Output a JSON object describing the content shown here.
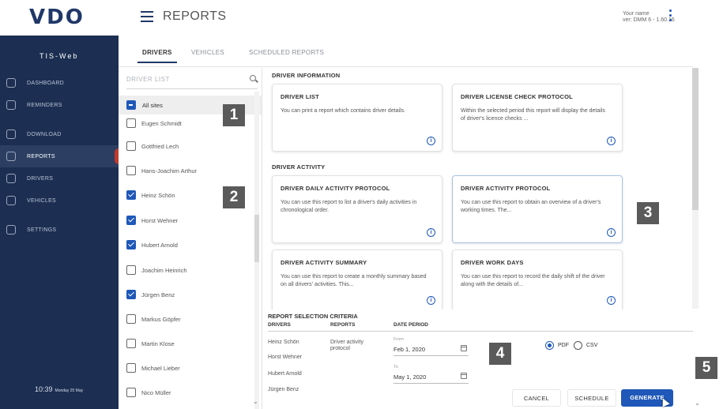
{
  "header": {
    "logo": "VDO",
    "page_title": "REPORTS",
    "user_name": "Your name",
    "user_version": "ver: DMM 6 - 1.60.16"
  },
  "sidebar": {
    "app_title": "TIS-Web",
    "items": [
      {
        "label": "DASHBOARD",
        "icon": "dashboard-icon"
      },
      {
        "label": "REMINDERS",
        "icon": "bell-icon"
      },
      {
        "label": "DOWNLOAD",
        "icon": "download-icon"
      },
      {
        "label": "REPORTS",
        "icon": "report-icon",
        "active": true
      },
      {
        "label": "DRIVERS",
        "icon": "driver-icon"
      },
      {
        "label": "VEHICLES",
        "icon": "truck-icon"
      },
      {
        "label": "SETTINGS",
        "icon": "settings-icon"
      }
    ],
    "clock_time": "10:39",
    "clock_date": "Monday 25 May"
  },
  "tabs": [
    {
      "label": "DRIVERS",
      "active": true
    },
    {
      "label": "VEHICLES",
      "active": false
    },
    {
      "label": "SCHEDULED REPORTS",
      "active": false
    }
  ],
  "driver_list": {
    "search_placeholder": "DRIVER LIST",
    "all_sites_label": "All sites",
    "drivers": [
      {
        "name": "Eugen Schmidt",
        "checked": false
      },
      {
        "name": "Gottfried Lech",
        "checked": false
      },
      {
        "name": "Hans-Joachim Arthur",
        "checked": false
      },
      {
        "name": "Heinz Schön",
        "checked": true
      },
      {
        "name": "Horst Wehner",
        "checked": true
      },
      {
        "name": "Hubert Arnold",
        "checked": true
      },
      {
        "name": "Joachim Heinrich",
        "checked": false
      },
      {
        "name": "Jürgen Benz",
        "checked": true
      },
      {
        "name": "Markus Göpfer",
        "checked": false
      },
      {
        "name": "Martin Klose",
        "checked": false
      },
      {
        "name": "Michael Lieber",
        "checked": false
      },
      {
        "name": "Nico Müller",
        "checked": false
      }
    ]
  },
  "reports": {
    "section_driver_info": "DRIVER INFORMATION",
    "section_driver_activity": "DRIVER ACTIVITY",
    "cards": [
      {
        "title": "DRIVER LIST",
        "desc": "You can print a report which contains driver details."
      },
      {
        "title": "DRIVER LICENSE CHECK PROTOCOL",
        "desc": "Within the selected period this report will display the details of driver's licence checks ..."
      },
      {
        "title": "DRIVER DAILY ACTIVITY PROTOCOL",
        "desc": "You can use this report to list a driver's daily activities in chronological order."
      },
      {
        "title": "DRIVER ACTIVITY PROTOCOL",
        "desc": "You can use this report to obtain an overview of a driver's working times. The..."
      },
      {
        "title": "DRIVER ACTIVITY SUMMARY",
        "desc": "You can use this report to create a monthly summary based on all drivers' activities. This..."
      },
      {
        "title": "DRIVER WORK DAYS",
        "desc": "You can use this report to record the daily shift of the driver along with the details of..."
      }
    ]
  },
  "criteria": {
    "title": "REPORT SELECTION CRITERIA",
    "col_drivers": "DRIVERS",
    "col_reports": "REPORTS",
    "col_period": "DATE PERIOD",
    "selected_drivers": [
      "Heinz Schön",
      "Horst Wehner",
      "Hubert Arnold",
      "Jürgen Benz"
    ],
    "selected_report": "Driver activity protocol",
    "from_label": "From",
    "from_value": "Feb 1, 2020",
    "to_label": "To",
    "to_value": "May 1, 2020",
    "format_pdf": "PDF",
    "format_csv": "CSV",
    "cancel": "CANCEL",
    "schedule": "SCHEDULE",
    "generate": "GENERATE"
  },
  "callouts": [
    "1",
    "2",
    "3",
    "4",
    "5"
  ],
  "colors": {
    "sidebar_bg": "#1c2f52",
    "accent": "#1f58b8",
    "active_marker": "#c0392b"
  }
}
